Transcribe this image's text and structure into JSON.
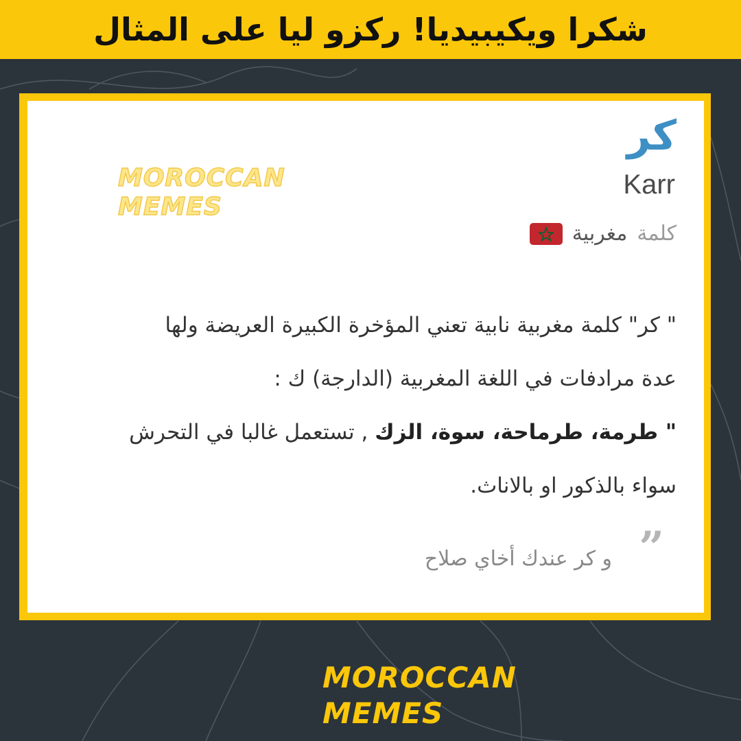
{
  "banner": {
    "title": "شكرا ويكيبيديا! ركزو ليا على المثال"
  },
  "entry": {
    "word": "كر",
    "transliteration": "Karr",
    "word_type": "كلمة",
    "language": "مغربية",
    "definition": {
      "line1": "\" كر\" كلمة مغربية نابية تعني المؤخرة الكبيرة العريضة ولها",
      "line2": "عدة مرادفات في اللغة المغربية (الدارجة) ك :",
      "synonyms": "\" طرمة، طرماحة، سوة، الزك",
      "line3_rest": " , تستعمل غالبا في التحرش",
      "line4": "سواء بالذكور او بالاناث."
    },
    "example": "و كر عندك أخاي صلاح"
  },
  "watermark": {
    "line1": "MOROCCAN",
    "line2": "MEMES"
  },
  "colors": {
    "banner_bg": "#fbc70a",
    "page_bg": "#2b333b",
    "title_blue": "#3e8fc4",
    "flag_red": "#c1272d",
    "flag_star_green": "#006233"
  },
  "icons": {
    "flag": "morocco-flag-icon",
    "quote": "quote-mark-icon"
  }
}
